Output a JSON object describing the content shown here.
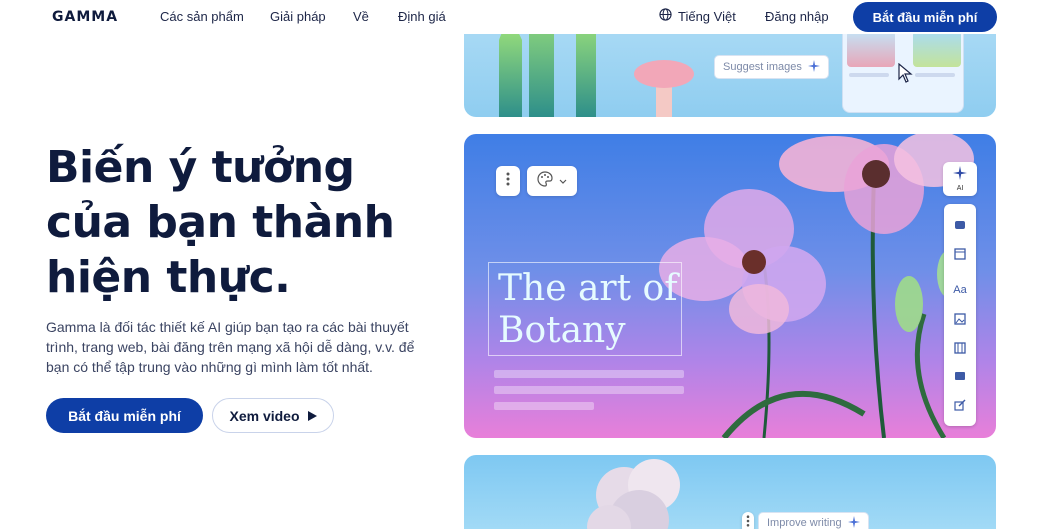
{
  "header": {
    "logo": "GAMMA",
    "nav": [
      "Các sản phẩm",
      "Giải pháp",
      "Về",
      "Định giá"
    ],
    "language": "Tiếng Việt",
    "login": "Đăng nhập",
    "cta": "Bắt đầu miễn phí"
  },
  "hero": {
    "title": "Biến ý tưởng của bạn thành hiện thực.",
    "description": "Gamma là đối tác thiết kế AI giúp bạn tạo ra các bài thuyết trình, trang web, bài đăng trên mạng xã hội dễ dàng, v.v. để bạn có thể tập trung vào những gì mình làm tốt nhất.",
    "primary_button": "Bắt đầu miễn phí",
    "secondary_button": "Xem video"
  },
  "cards": {
    "top": {
      "suggest_label": "Suggest images"
    },
    "main": {
      "title": "The art of Botany",
      "ai_badge": "AI",
      "font_tool": "Aa"
    },
    "bottom": {
      "improve_label": "Improve writing"
    }
  },
  "colors": {
    "brand": "#0e3ea6",
    "text_dark": "#0f1b3d"
  }
}
